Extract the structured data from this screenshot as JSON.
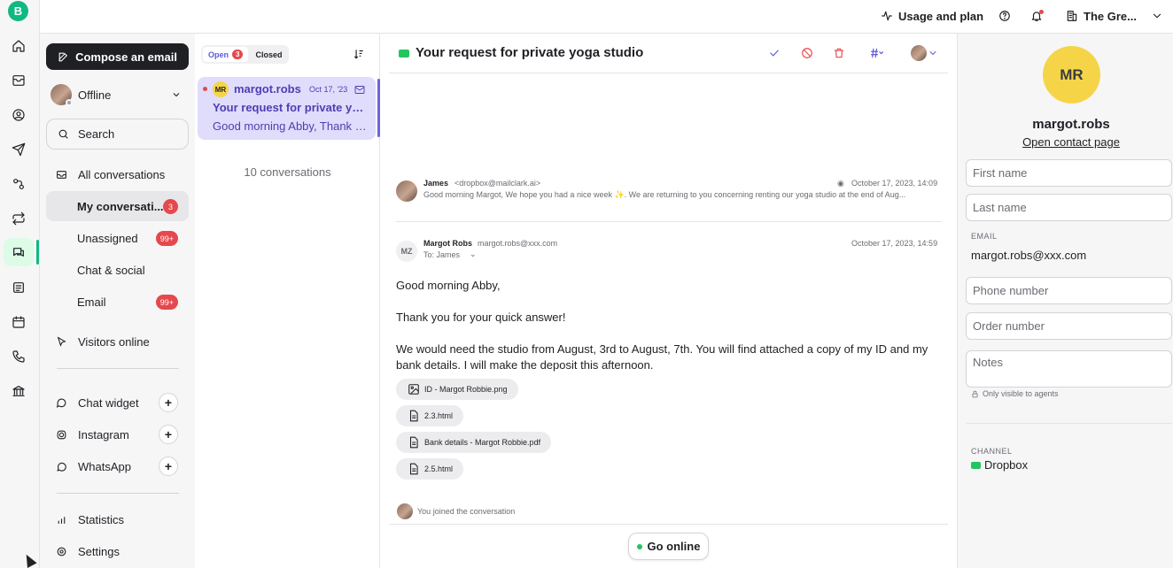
{
  "app": {
    "logo_letter": "B"
  },
  "topbar": {
    "usage_label": "Usage and plan",
    "workspace_label": "The Gre..."
  },
  "sidebar": {
    "compose_label": "Compose an email",
    "status_label": "Offline",
    "search_label": "Search",
    "items": [
      {
        "label": "All conversations"
      },
      {
        "label": "My conversati...",
        "badge": "3"
      },
      {
        "label": "Unassigned",
        "badge": "99+"
      },
      {
        "label": "Chat & social"
      },
      {
        "label": "Email",
        "badge": "99+"
      },
      {
        "label": "Visitors online"
      },
      {
        "label": "Chat widget"
      },
      {
        "label": "Instagram"
      },
      {
        "label": "WhatsApp"
      },
      {
        "label": "Statistics"
      },
      {
        "label": "Settings"
      }
    ]
  },
  "convlist": {
    "tab_open": "Open",
    "tab_open_count": "3",
    "tab_closed": "Closed",
    "card": {
      "initials": "MR",
      "name": "margot.robs",
      "date": "Oct 17, '23",
      "subject": "Your request for private yoga studio",
      "preview": "Good morning Abby, Thank you for your quick answer!"
    },
    "count_label": "10 conversations"
  },
  "main": {
    "title": "Your request for private yoga studio",
    "msg1": {
      "from": "James",
      "email": "<dropbox@mailclark.ai>",
      "date": "October 17, 2023, 14:09",
      "preview": "Good morning Margot,  We hope you had a nice week ✨.  We are returning to you concerning renting our yoga studio at the end of Aug..."
    },
    "msg2": {
      "initials": "MZ",
      "from": "Margot Robs",
      "email": "margot.robs@xxx.com",
      "date": "October 17, 2023, 14:59",
      "to": "To: James",
      "line1": "Good morning Abby,",
      "line2": "Thank you for your quick answer!",
      "line3": "We would need the studio from August, 3rd to August, 7th. You will find attached a copy of my ID and my bank details. I will make the deposit this afternoon."
    },
    "attachments": [
      {
        "name": "ID - Margot Robbie.png"
      },
      {
        "name": "2.3.html"
      },
      {
        "name": "Bank details - Margot Robbie.pdf"
      },
      {
        "name": "2.5.html"
      }
    ],
    "joined_text": "You joined the conversation",
    "go_online_label": "Go online"
  },
  "contact": {
    "initials": "MR",
    "name": "margot.robs",
    "link": "Open contact page",
    "first_name_placeholder": "First name",
    "last_name_placeholder": "Last name",
    "email_label": "EMAIL",
    "email_value": "margot.robs@xxx.com",
    "phone_placeholder": "Phone number",
    "order_placeholder": "Order number",
    "notes_placeholder": "Notes",
    "notes_hint": "Only visible to agents",
    "channel_label": "CHANNEL",
    "channel_value": "Dropbox"
  },
  "colors": {
    "accent": "#10b981",
    "selected_conv": "#e0dcfb",
    "badge": "#e5484d",
    "contact_avatar": "#f5d547"
  }
}
